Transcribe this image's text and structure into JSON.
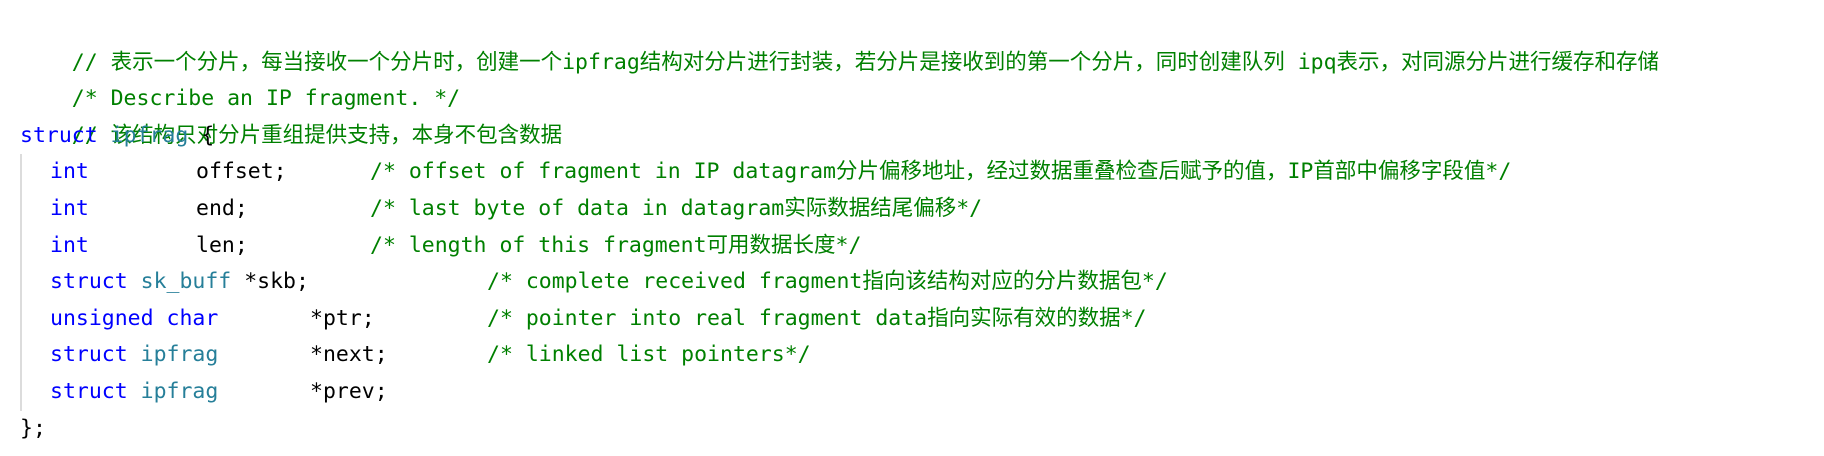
{
  "code": {
    "comment_intro": "// 表示一个分片，每当接收一个分片时，创建一个ipfrag结构对分片进行封装，若分片是接收到的第一个分片，同时创建队列 ipq表示，对同源分片进行缓存和存储",
    "comment_describe": "/* Describe an IP fragment. */",
    "comment_support": "// 该结构只对分片重组提供支持，本身不包含数据",
    "struct_keyword": "struct",
    "struct_name": "ipfrag",
    "open_brace": "{",
    "fields": [
      {
        "type_kw": "int",
        "type_name": "",
        "name": "offset;",
        "comment": "/* offset of fragment in IP datagram分片偏移地址，经过数据重叠检查后赋予的值，IP首部中偏移字段值*/"
      },
      {
        "type_kw": "int",
        "type_name": "",
        "name": "end;",
        "comment": "/* last byte of data in datagram实际数据结尾偏移*/"
      },
      {
        "type_kw": "int",
        "type_name": "",
        "name": "len;",
        "comment": "/* length of this fragment可用数据长度*/"
      },
      {
        "type_kw": "struct",
        "type_name": "sk_buff",
        "name": "*skb;",
        "comment": "/* complete received fragment指向该结构对应的分片数据包*/"
      },
      {
        "type_kw": "unsigned char",
        "type_name": "",
        "name": "*ptr;",
        "comment": "/* pointer into real fragment data指向实际有效的数据*/"
      },
      {
        "type_kw": "struct",
        "type_name": "ipfrag",
        "name": "*next;",
        "comment": "/* linked list pointers*/"
      },
      {
        "type_kw": "struct",
        "type_name": "ipfrag",
        "name": "*prev;",
        "comment": ""
      }
    ],
    "close_brace": "};"
  },
  "colors": {
    "comment": "#008000",
    "keyword": "#0000ff",
    "type": "#267f99",
    "plain": "#000000",
    "indent_guide": "#dcdcdc"
  }
}
